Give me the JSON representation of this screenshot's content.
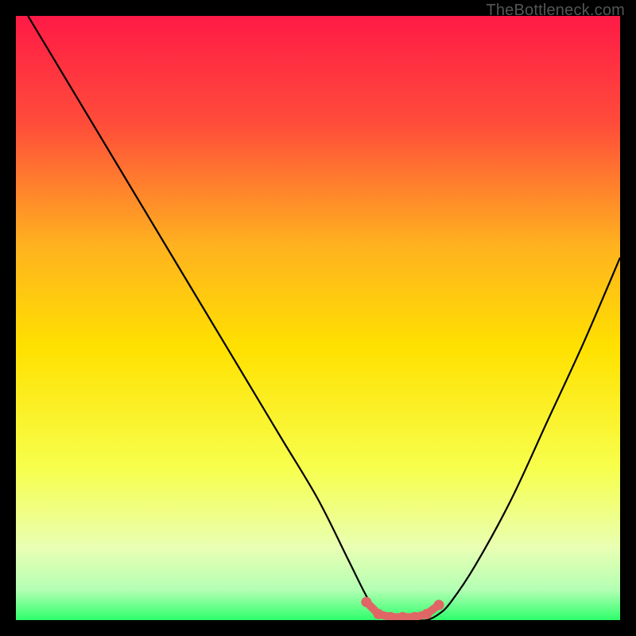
{
  "watermark": "TheBottleneck.com",
  "colors": {
    "frame": "#000000",
    "curve": "#000000",
    "marker": "#e06666",
    "grad_top": "#ff1a46",
    "grad_mid_upper": "#ff8a2a",
    "grad_mid": "#ffe100",
    "grad_mid_lower": "#f7ff66",
    "grad_low": "#d9ffb3",
    "grad_bottom": "#2eff6b"
  },
  "chart_data": {
    "type": "line",
    "title": "",
    "xlabel": "",
    "ylabel": "",
    "xlim": [
      0,
      100
    ],
    "ylim": [
      0,
      100
    ],
    "series": [
      {
        "name": "bottleneck-curve",
        "x": [
          2,
          8,
          14,
          20,
          26,
          32,
          38,
          44,
          50,
          55,
          58,
          60,
          62,
          64,
          66,
          68,
          70,
          72,
          76,
          82,
          88,
          94,
          100
        ],
        "values": [
          100,
          90,
          80,
          70,
          60,
          50,
          40,
          30,
          20,
          10,
          4,
          1,
          0,
          0,
          0,
          0,
          1,
          3,
          9,
          20,
          33,
          46,
          60
        ]
      }
    ],
    "markers": {
      "name": "optimal-range",
      "x": [
        58,
        60,
        62,
        64,
        66,
        68,
        70
      ],
      "values": [
        3,
        1,
        0.5,
        0.5,
        0.5,
        1,
        2.5
      ]
    },
    "annotations": []
  }
}
